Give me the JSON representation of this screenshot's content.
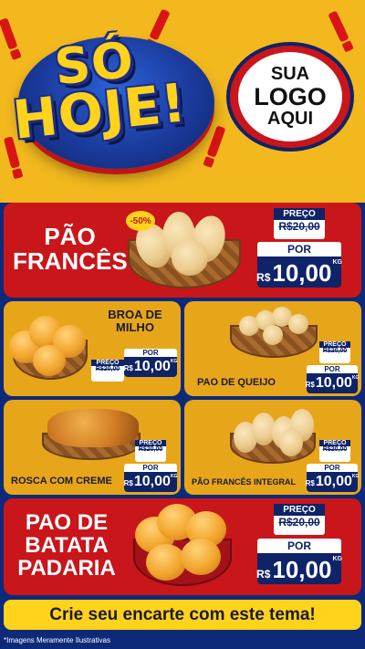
{
  "header": {
    "headline_line1": "SÓ",
    "headline_line2": "HOJE!",
    "logo_line1": "SUA",
    "logo_line2": "LOGO",
    "logo_line3": "AQUI"
  },
  "colors": {
    "brand_red": "#c8161b",
    "brand_blue": "#0e2368",
    "brand_yellow": "#ffd21c",
    "header_bg": "#f2b81e",
    "panel_gold": "#e7a61a"
  },
  "products": [
    {
      "name_lines": [
        "PÃO",
        "FRANCÊS"
      ],
      "discount": "-50%",
      "preco_label": "PREÇO",
      "old_price": "R$20,00",
      "por_label": "POR",
      "currency": "R$",
      "price": "10,00",
      "unit": "KG"
    },
    {
      "name_lines": [
        "BROA DE",
        "MILHO"
      ],
      "preco_label": "PREÇO",
      "old_price": "R$20,00",
      "por_label": "POR",
      "currency": "R$",
      "price": "10,00",
      "unit": "KG"
    },
    {
      "name_lines": [
        "PAO DE QUEIJO"
      ],
      "preco_label": "PREÇO",
      "old_price": "R$20,00",
      "por_label": "POR",
      "currency": "R$",
      "price": "10,00",
      "unit": "KG"
    },
    {
      "name_lines": [
        "ROSCA COM CREME"
      ],
      "preco_label": "PREÇO",
      "old_price": "R$20,00",
      "por_label": "POR",
      "currency": "R$",
      "price": "10,00",
      "unit": "KG"
    },
    {
      "name_lines": [
        "PÃO FRANCÊS INTEGRAL"
      ],
      "preco_label": "PREÇO",
      "old_price": "R$20,00",
      "por_label": "POR",
      "currency": "R$",
      "price": "10,00",
      "unit": "KG"
    },
    {
      "name_lines": [
        "PAO DE",
        "BATATA",
        "PADARIA"
      ],
      "preco_label": "PREÇO",
      "old_price": "R$20,00",
      "por_label": "POR",
      "currency": "R$",
      "price": "10,00",
      "unit": "KG"
    }
  ],
  "cta": "Crie seu encarte com este tema!",
  "footnote": "*Imagens Meramente Ilustrativas"
}
